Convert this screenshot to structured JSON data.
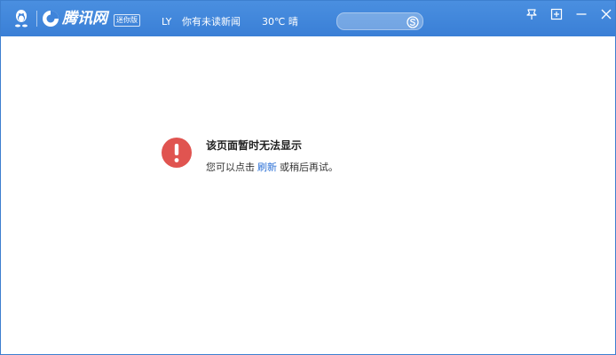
{
  "titlebar": {
    "brand_name": "腾讯网",
    "brand_badge": "迷你版",
    "user_initials": "LY",
    "news_status": "你有未读新闻",
    "weather": "30℃ 晴",
    "search": {
      "value": "",
      "placeholder": "",
      "icon": "sogou-search-icon"
    },
    "controls": [
      "pin-icon",
      "maximize-icon",
      "minimize-icon",
      "close-icon"
    ]
  },
  "error": {
    "title": "该页面暂时无法显示",
    "desc_before": "您可以点击",
    "refresh_label": "刷新",
    "desc_after": "或稍后再试。",
    "icon_color": "#e05450"
  },
  "colors": {
    "titlebar": "#3f84da",
    "link": "#2a6fd6"
  }
}
